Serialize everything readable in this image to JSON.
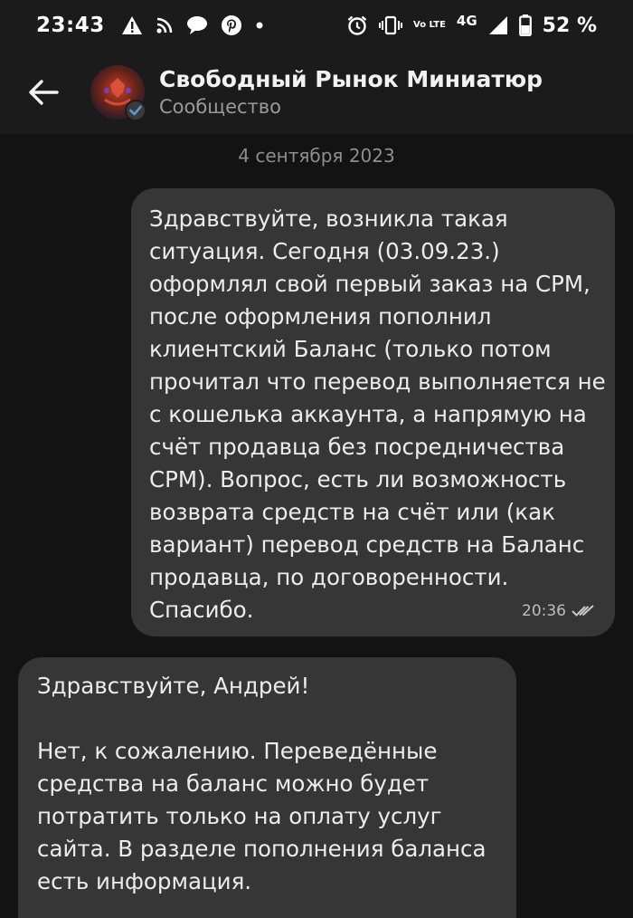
{
  "status_bar": {
    "time": "23:43",
    "battery_percent": "52 %",
    "network": "4G",
    "volte": "Vo LTE",
    "left_icons": [
      "warning-icon",
      "rss-icon",
      "chat-bubble-icon",
      "pinterest-icon",
      "dot-icon"
    ],
    "right_icons": [
      "alarm-icon",
      "vibrate-icon",
      "volte-icon",
      "signal-icon",
      "battery-icon"
    ]
  },
  "header": {
    "title": "Свободный Рынок Миниатюр",
    "subtitle": "Сообщество"
  },
  "conversation": {
    "date": "4 сентября 2023",
    "messages": [
      {
        "direction": "outgoing",
        "lines": [
          "Здравствуйте, возникла такая",
          "ситуация. Сегодня (03.09.23.)",
          "оформлял свой первый заказ на СРМ,",
          "после оформления пополнил",
          "клиентский Баланс (только потом",
          "прочитал что перевод выполняется не",
          "с кошелька аккаунта, а напрямую на",
          "счёт продавца без посредничества",
          "СРМ). Вопрос, есть ли возможность",
          "возврата средств на счёт или (как",
          "вариант) перевод средств на Баланс",
          "продавца, по договоренности.",
          "Спасибо."
        ],
        "time": "20:36",
        "status": "read"
      },
      {
        "direction": "incoming",
        "lines": [
          "Здравствуйте, Андрей!",
          "",
          "Нет, к сожалению. Переведённые",
          "средства на баланс можно будет",
          "потратить только на оплату услуг",
          "сайта. В разделе пополнения баланса",
          "есть информация."
        ]
      }
    ]
  },
  "colors": {
    "background": "#131313",
    "bar": "#1b1b1b",
    "bubble": "#363636",
    "text": "#ececec",
    "muted": "#8e8e8e",
    "verified": "#5b9bd5"
  }
}
